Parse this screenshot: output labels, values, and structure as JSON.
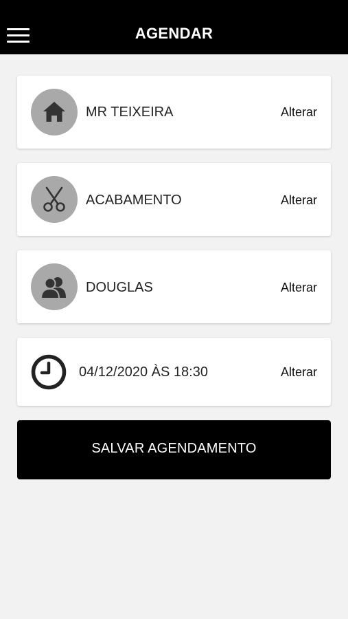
{
  "header": {
    "title": "AGENDAR",
    "menu_icon": "hamburger-menu-icon"
  },
  "cards": [
    {
      "icon": "home-icon",
      "label": "MR TEIXEIRA",
      "action": "Alterar"
    },
    {
      "icon": "scissors-icon",
      "label": "ACABAMENTO",
      "action": "Alterar"
    },
    {
      "icon": "users-icon",
      "label": "DOUGLAS",
      "action": "Alterar"
    },
    {
      "icon": "clock-icon",
      "label": "04/12/2020 ÀS 18:30",
      "action": "Alterar"
    }
  ],
  "save_button": {
    "label": "SALVAR AGENDAMENTO"
  },
  "colors": {
    "header_bg": "#000000",
    "page_bg": "#f2f2f2",
    "icon_circle": "#a9a9a9",
    "icon_glyph": "#333333",
    "button_bg": "#000000"
  }
}
